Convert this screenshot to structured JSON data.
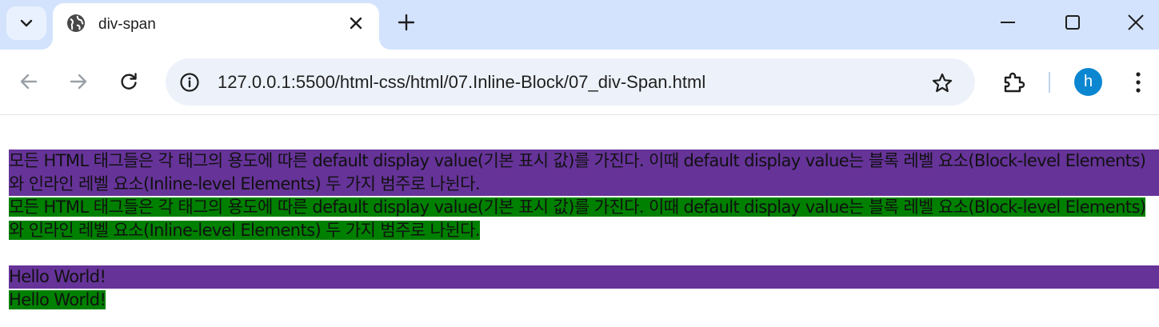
{
  "browser": {
    "tab": {
      "title": "div-span"
    },
    "address_bar": {
      "url": "127.0.0.1:5500/html-css/html/07.Inline-Block/07_div-Span.html"
    },
    "profile": {
      "avatar_letter": "h",
      "avatar_color": "#0b86d1"
    },
    "colors": {
      "tabstrip": "#d3e3fd",
      "omnibox": "#edf2fa"
    }
  },
  "page": {
    "paragraph_text": "모든 HTML 태그들은 각 태그의 용도에 따른 default display value(기본 표시 값)를 가진다. 이때 default display value는 블록 레벨 요소(Block-level Elements)와 인라인 레벨 요소(Inline-level Elements) 두 가지 범주로 나뉜다.",
    "paragraph_span_text": "모든 HTML 태그들은 각 태그의 용도에 따른 default display value(기본 표시 값)를 가진다. 이때 default display value는 블록 레벨 요소(Block-level Elements)와 인라인 레벨 요소(Inline-level Elements) 두 가지 범주로 나뉜다.",
    "hello_div_text": "Hello World!",
    "hello_span_text": "Hello World!",
    "colors": {
      "div_background": "#663399",
      "span_background": "#008000"
    }
  }
}
